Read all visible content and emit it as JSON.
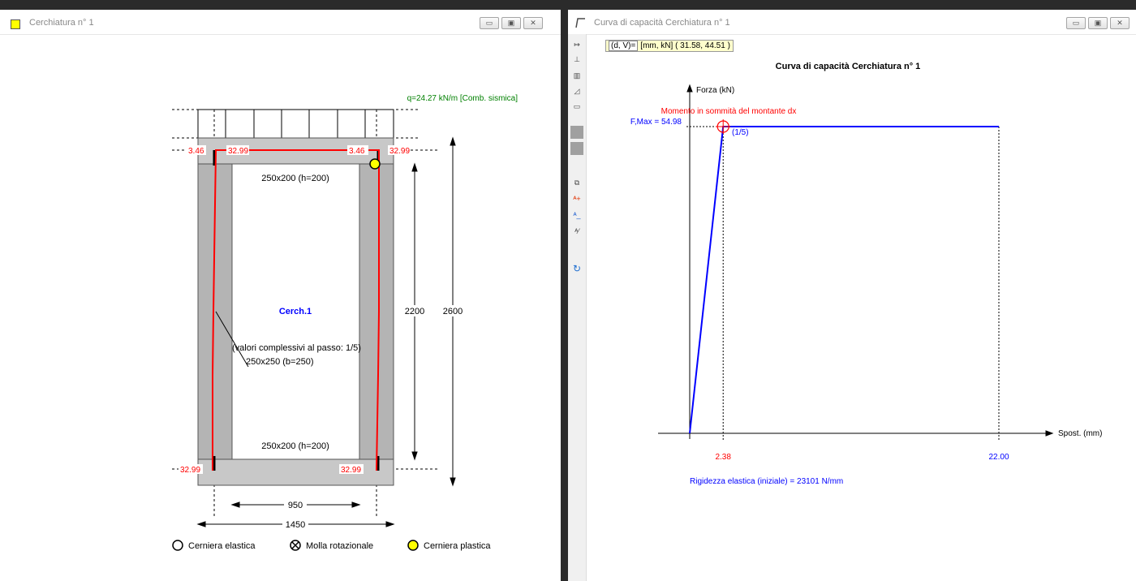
{
  "left_window": {
    "title": "Cerchiatura n° 1",
    "load_label": "q=24.27 kN/m [Comb. sismica]",
    "moment_labels": {
      "top_left_a": "3.46",
      "top_left_b": "32.99",
      "top_right_a": "3.46",
      "top_right_b": "32.99",
      "bottom_left": "32.99",
      "bottom_right": "32.99"
    },
    "top_beam_label": "250x200 (h=200)",
    "bottom_beam_label": "250x200 (h=200)",
    "frame_name": "Cerch.1",
    "note_line": "(valori complessivi al passo: 1/5)",
    "column_label": "250x250 (b=250)",
    "dim_inner_height": "2200",
    "dim_total_height": "2600",
    "dim_inner_width": "950",
    "dim_total_width": "1450",
    "legend": {
      "elastic_hinge": "Cerniera elastica",
      "rotational_spring": "Molla rotazionale",
      "plastic_hinge": "Cerniera plastica"
    }
  },
  "right_window": {
    "title": "Curva di capacità Cerchiatura n° 1",
    "coord_key": "(d, V)=",
    "coord_value": "[mm, kN]  ( 31.58, 44.51 )",
    "toolbar_icons": [
      "axis-arrows-icon",
      "axis-scale-icon",
      "bar-chart-icon",
      "curve-chart-icon",
      "number-format-icon",
      "gray-square-icon",
      "gray-square-icon",
      "copy-icon",
      "text-add-icon",
      "text-remove-icon",
      "text-edit-icon",
      "refresh-icon"
    ]
  },
  "chart_data": {
    "type": "line",
    "title": "Curva di capacità Cerchiatura n° 1",
    "xlabel": "Spost. (mm)",
    "ylabel": "Forza (kN)",
    "x_ticks": [
      "2.38",
      "22.00"
    ],
    "fmax_label": "F,Max = 54.98",
    "annotation": "Momento in sommità del montante dx",
    "step_label": "(1/5)",
    "stiffness_label": "Rigidezza elastica (iniziale) = 23101 N/mm",
    "series": [
      {
        "x": [
          0,
          2.38,
          22.0
        ],
        "y": [
          0,
          54.98,
          54.98
        ],
        "color": "#0000ff"
      }
    ],
    "marked_point": {
      "x": 2.38,
      "y": 54.98
    }
  },
  "colors": {
    "red": "#ff0000",
    "blue": "#0000ff",
    "green": "#008000",
    "gray": "#c8c8c8"
  }
}
